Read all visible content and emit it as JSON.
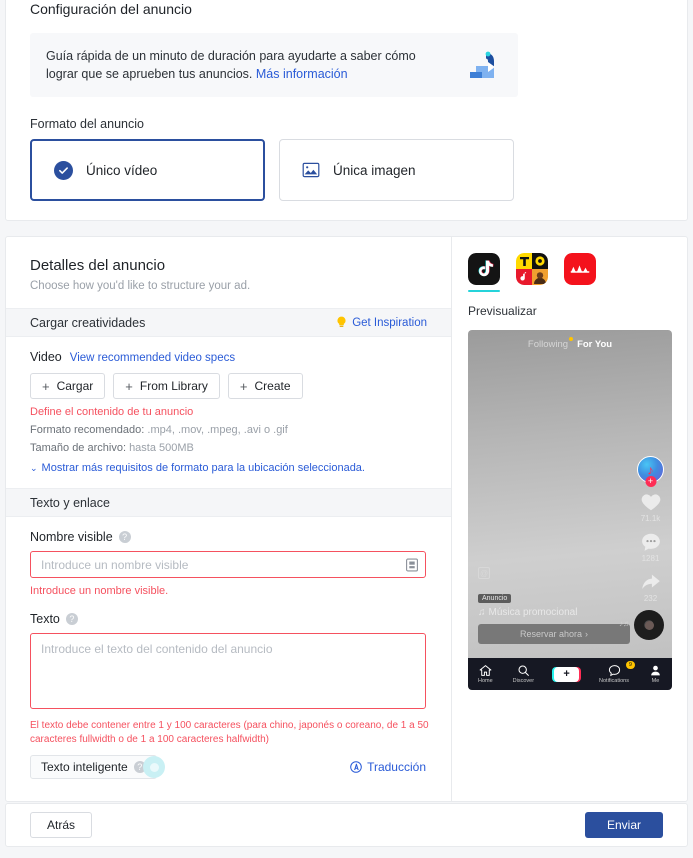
{
  "setup": {
    "title": "Configuración del anuncio",
    "banner": {
      "text": "Guía rápida de un minuto de duración para ayudarte a saber cómo lograr que se aprueben tus anuncios.",
      "link": "Más información",
      "icon": "video-guide-icon"
    },
    "format_label": "Formato del anuncio",
    "formats": [
      {
        "label": "Único vídeo",
        "selected": true,
        "icon": "check-circle-icon"
      },
      {
        "label": "Única imagen",
        "selected": false,
        "icon": "image-icon"
      }
    ]
  },
  "details": {
    "title": "Detalles del anuncio",
    "subtitle": "Choose how you'd like to structure your ad.",
    "upload_section": {
      "title": "Cargar creatividades",
      "inspiration_label": "Get Inspiration",
      "inspiration_icon": "lightbulb-icon"
    },
    "video": {
      "label": "Video",
      "specs_link": "View recommended video specs",
      "buttons": [
        "Cargar",
        "From Library",
        "Create"
      ],
      "error": "Define el contenido de tu anuncio",
      "format_key": "Formato recomendado:",
      "format_value": ".mp4, .mov, .mpeg, .avi o .gif",
      "size_key": "Tamaño de archivo:",
      "size_value": "hasta 500MB",
      "more_requirements": "Mostrar más requisitos de formato para la ubicación seleccionada."
    },
    "text_section": {
      "title": "Texto y enlace",
      "display_name": {
        "label": "Nombre visible",
        "placeholder": "Introduce un nombre visible",
        "value": "",
        "error": "Introduce un nombre visible.",
        "suffix_icon": "library-icon"
      },
      "text": {
        "label": "Texto",
        "placeholder": "Introduce el texto del contenido del anuncio",
        "value": "",
        "error": "El texto debe contener entre 1 y 100 caracteres (para chino, japonés o coreano, de 1 a 50 caracteres fullwidth o de 1 a 100 caracteres halfwidth)"
      },
      "smart_text_label": "Texto inteligente",
      "translation_label": "Traducción",
      "translation_icon": "translate-icon",
      "loading_icon": "spinner-icon"
    }
  },
  "preview": {
    "platforms": [
      {
        "name": "tiktok-icon",
        "active": true
      },
      {
        "name": "topbuzz-icon",
        "active": false
      },
      {
        "name": "buzzvideo-icon",
        "active": false
      }
    ],
    "label": "Previsualizar",
    "phone": {
      "tab_following": "Following",
      "tab_foryou": "For You",
      "handle": "@",
      "ad_badge": "Anuncio",
      "music": "Música promocional",
      "music_note": "♫",
      "cta": "Reservar ahora",
      "cta_chevron": "›",
      "likes": "71.1k",
      "comments": "1281",
      "shares": "232",
      "nav": [
        {
          "label": "Home",
          "icon": "home-icon"
        },
        {
          "label": "Discover",
          "icon": "search-icon"
        },
        {
          "label": "",
          "icon": "plus-icon"
        },
        {
          "label": "Notifications",
          "icon": "inbox-icon",
          "badge": "9"
        },
        {
          "label": "Me",
          "icon": "profile-icon"
        }
      ]
    }
  },
  "footer": {
    "back_label": "Atrás",
    "submit_label": "Enviar"
  },
  "colors": {
    "primary": "#2b4f9e",
    "link": "#2a5bd7",
    "error": "#f5515f",
    "accent_cyan": "#25d3da"
  }
}
